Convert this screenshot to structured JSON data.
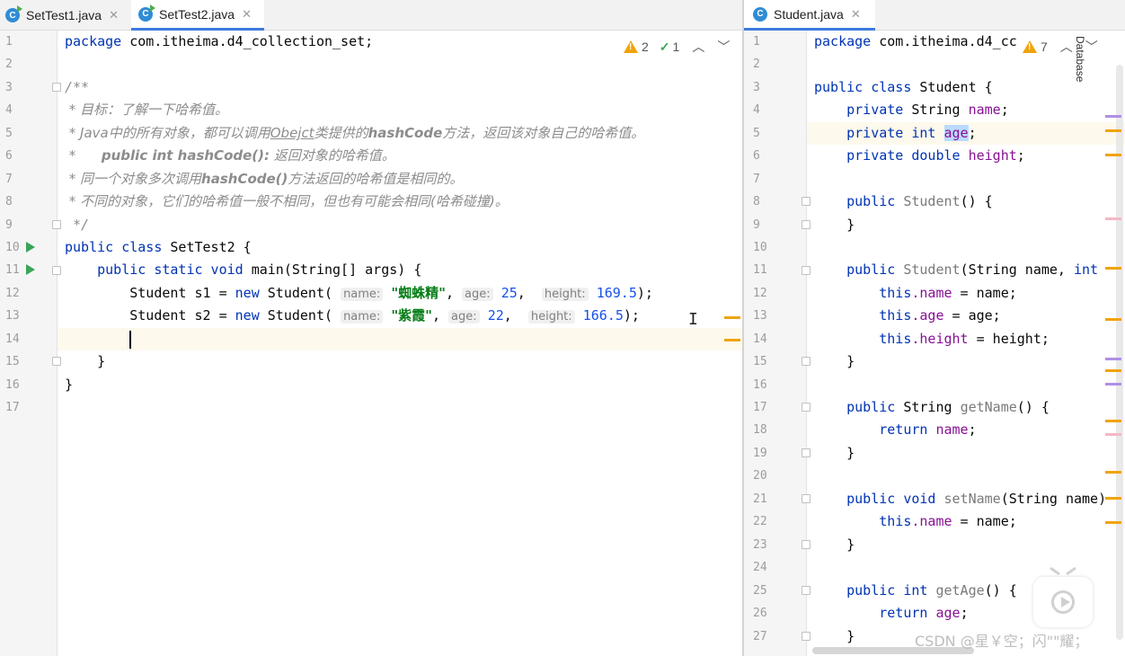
{
  "left_editor": {
    "tabs": [
      {
        "label": "SetTest1.java",
        "active": false
      },
      {
        "label": "SetTest2.java",
        "active": true
      }
    ],
    "inspections": {
      "warnings": "2",
      "weak_warnings": "1"
    },
    "line_numbers": [
      "1",
      "2",
      "3",
      "4",
      "5",
      "6",
      "7",
      "8",
      "9",
      "10",
      "11",
      "12",
      "13",
      "14",
      "15",
      "16",
      "17"
    ],
    "code": {
      "l1_pkg": "package",
      "l1_name": " com.itheima.d4_collection_set;",
      "l3": "/**",
      "l4": " * 目标：了解一下哈希值。",
      "l5_a": " * Java中的所有对象，都可以调用",
      "l5_b": "Obejct",
      "l5_c": "类提供的",
      "l5_d": "hashCode",
      "l5_e": "方法，返回该对象自己的哈希值。",
      "l6_a": " *      ",
      "l6_b": "public int hashCode():",
      "l6_c": " 返回对象的哈希值。",
      "l7_a": " * 同一个对象多次调用",
      "l7_b": "hashCode()",
      "l7_c": "方法返回的哈希值是相同的。",
      "l8": " * 不同的对象，它们的哈希值一般不相同，但也有可能会相同(哈希碰撞)。",
      "l9": " */",
      "l10_kw": "public class",
      "l10_rest": " SetTest2 {",
      "l11_kw": "    public static void",
      "l11_rest": " main(String[] args) {",
      "l12_a": "        Student s1 = ",
      "l12_new": "new",
      "l12_b": " Student(",
      "l12_h1": "name:",
      "l12_v1": "\"蜘蛛精\"",
      "l12_c1": ",",
      "l12_h2": "age:",
      "l12_v2": "25",
      "l12_c2": ",",
      "l12_h3": "height:",
      "l12_v3": "169.5",
      "l12_end": ");",
      "l13_a": "        Student s2 = ",
      "l13_new": "new",
      "l13_b": " Student(",
      "l13_h1": "name:",
      "l13_v1": "\"紫霞\"",
      "l13_c1": ",",
      "l13_h2": "age:",
      "l13_v2": "22",
      "l13_c2": ",",
      "l13_h3": "height:",
      "l13_v3": "166.5",
      "l13_end": ");",
      "l14": "        ",
      "l15": "    }",
      "l16": "}"
    }
  },
  "right_editor": {
    "tabs": [
      {
        "label": "Student.java",
        "active": true
      }
    ],
    "inspections": {
      "warnings": "7"
    },
    "side_label": "Database",
    "line_numbers": [
      "1",
      "2",
      "3",
      "4",
      "5",
      "6",
      "7",
      "8",
      "9",
      "10",
      "11",
      "12",
      "13",
      "14",
      "15",
      "16",
      "17",
      "18",
      "19",
      "20",
      "21",
      "22",
      "23",
      "24",
      "25",
      "26",
      "27"
    ],
    "code": {
      "l1_pkg": "package",
      "l1_name": " com.itheima.d4_cc",
      "l3_kw": "public class",
      "l3_rest": " Student {",
      "l4_kw": "    private",
      "l4_t": " String ",
      "l4_f": "name",
      "l4_e": ";",
      "l5_kw": "    private int ",
      "l5_f": "age",
      "l5_e": ";",
      "l6_kw": "    private double ",
      "l6_f": "height",
      "l6_e": ";",
      "l8_kw": "    public",
      "l8_fn": " Student",
      "l8_e": "() {",
      "l9": "    }",
      "l11_kw": "    public",
      "l11_fn": " Student",
      "l11_a": "(String name, ",
      "l11_int": "int",
      "l12_this": "        this",
      "l12_f": ".name",
      "l12_e": " = name;",
      "l13_this": "        this",
      "l13_f": ".age",
      "l13_e": " = age;",
      "l14_this": "        this",
      "l14_f": ".height",
      "l14_e": " = height;",
      "l15": "    }",
      "l17_kw": "    public",
      "l17_t": " String ",
      "l17_fn": "getName",
      "l17_e": "() {",
      "l18_kw": "        return ",
      "l18_f": "name",
      "l18_e": ";",
      "l19": "    }",
      "l21_kw": "    public void ",
      "l21_fn": "setName",
      "l21_e": "(String name)",
      "l22_this": "        this",
      "l22_f": ".name",
      "l22_e": " = name;",
      "l23": "    }",
      "l25_kw": "    public int ",
      "l25_fn": "getAge",
      "l25_e": "() {",
      "l26_kw": "        return ",
      "l26_f": "age",
      "l26_e": ";",
      "l27": "    }"
    }
  },
  "watermark": "CSDN @星￥空；闪\"\"耀；",
  "colors": {
    "keyword": "#0033b3",
    "field": "#871094",
    "string": "#067d17",
    "number": "#1750eb",
    "comment": "#8c8c8c",
    "warning": "#f0a30a",
    "accent": "#3d7be0"
  }
}
